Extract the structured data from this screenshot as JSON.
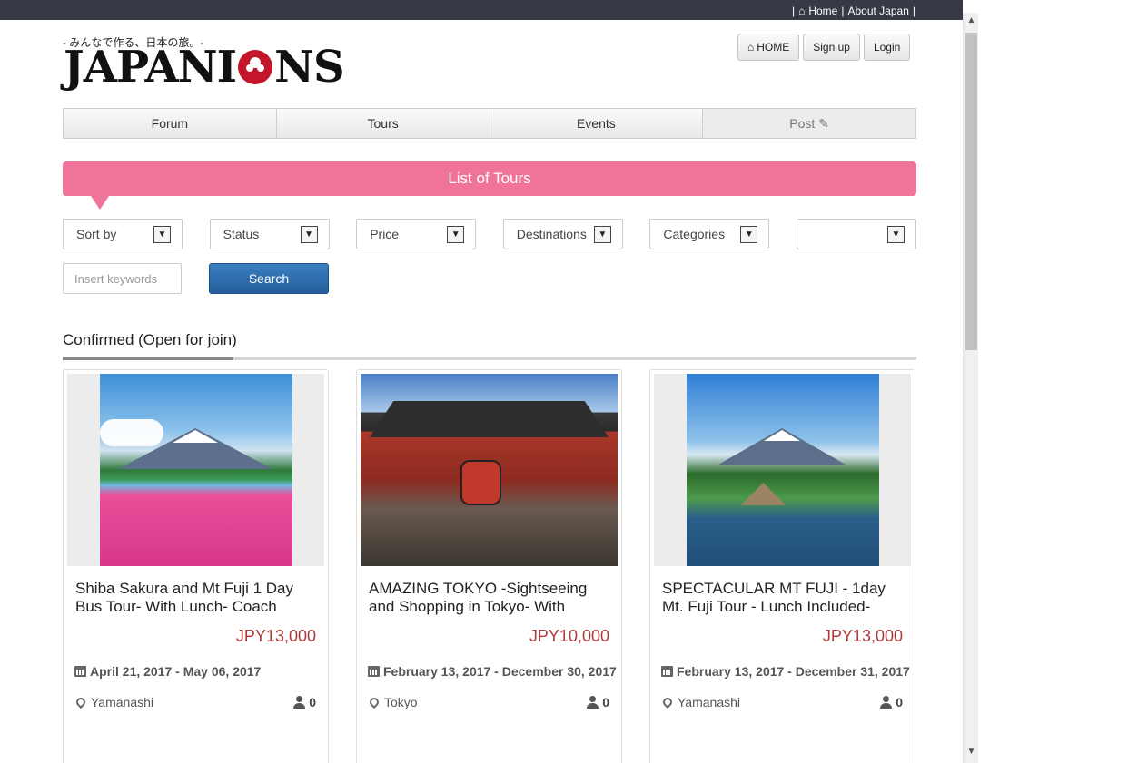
{
  "topbar": {
    "separator": "|",
    "home": "Home",
    "about": "About Japan"
  },
  "header": {
    "tagline": "- みんなで作る、日本の旅。-",
    "logo_left": "JAPANI",
    "logo_right": "NS",
    "buttons": {
      "home": "HOME",
      "signup": "Sign up",
      "login": "Login"
    }
  },
  "nav": {
    "forum": "Forum",
    "tours": "Tours",
    "events": "Events",
    "post": "Post"
  },
  "banner": {
    "title": "List of Tours"
  },
  "filters": {
    "sort": "Sort by",
    "status": "Status",
    "price": "Price",
    "destinations": "Destinations",
    "categories": "Categories",
    "extra": ""
  },
  "search": {
    "placeholder": "Insert keywords",
    "button": "Search"
  },
  "section": {
    "title": "Confirmed (Open for join)"
  },
  "tours": [
    {
      "title": "Shiba Sakura and Mt Fuji 1 Day Bus Tour- With Lunch- Coach",
      "price": "JPY13,000",
      "dates": "April 21, 2017 - May 06, 2017",
      "location": "Yamanashi",
      "count": "0"
    },
    {
      "title": "AMAZING TOKYO -Sightseeing and Shopping in Tokyo- With",
      "price": "JPY10,000",
      "dates": "February 13, 2017 - December 30, 2017",
      "location": "Tokyo",
      "count": "0"
    },
    {
      "title": "SPECTACULAR MT FUJI - 1day Mt. Fuji Tour - Lunch Included-",
      "price": "JPY13,000",
      "dates": "February 13, 2017 - December 31, 2017",
      "location": "Yamanashi",
      "count": "0"
    }
  ]
}
